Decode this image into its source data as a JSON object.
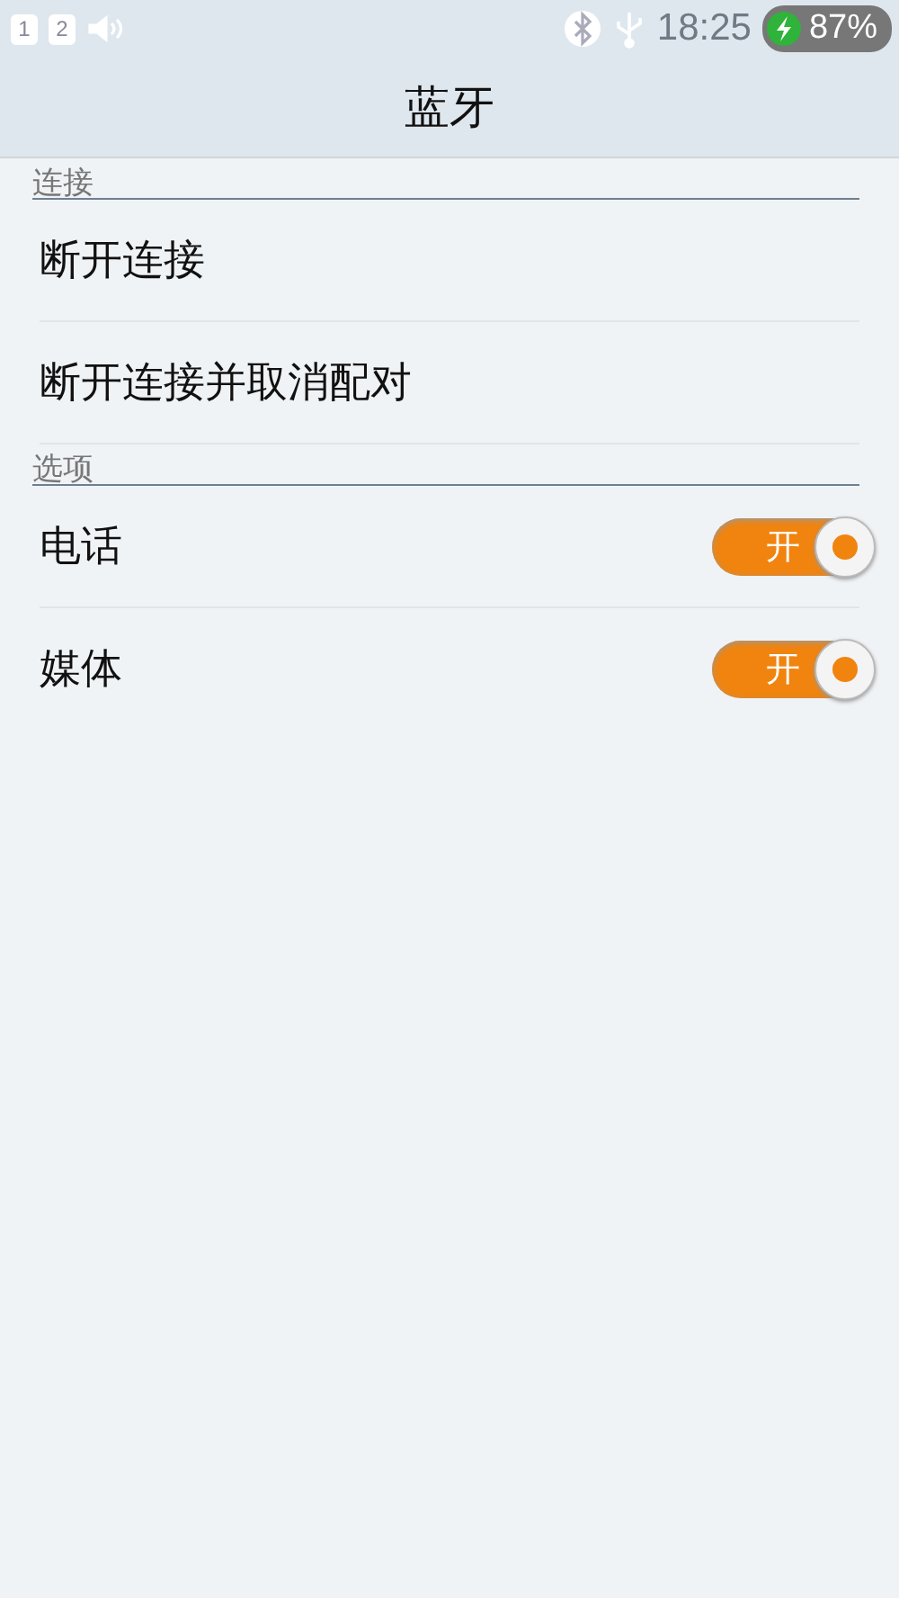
{
  "status_bar": {
    "sim_slots": [
      "1",
      "2"
    ],
    "time": "18:25",
    "battery": "87%",
    "charging": true
  },
  "title": "蓝牙",
  "sections": [
    {
      "header": "连接",
      "items": [
        {
          "kind": "action",
          "label": "断开连接"
        },
        {
          "kind": "action",
          "label": "断开连接并取消配对"
        }
      ]
    },
    {
      "header": "选项",
      "items": [
        {
          "kind": "toggle",
          "label": "电话",
          "on": true,
          "switch_text": "开"
        },
        {
          "kind": "toggle",
          "label": "媒体",
          "on": true,
          "switch_text": "开"
        }
      ]
    }
  ]
}
